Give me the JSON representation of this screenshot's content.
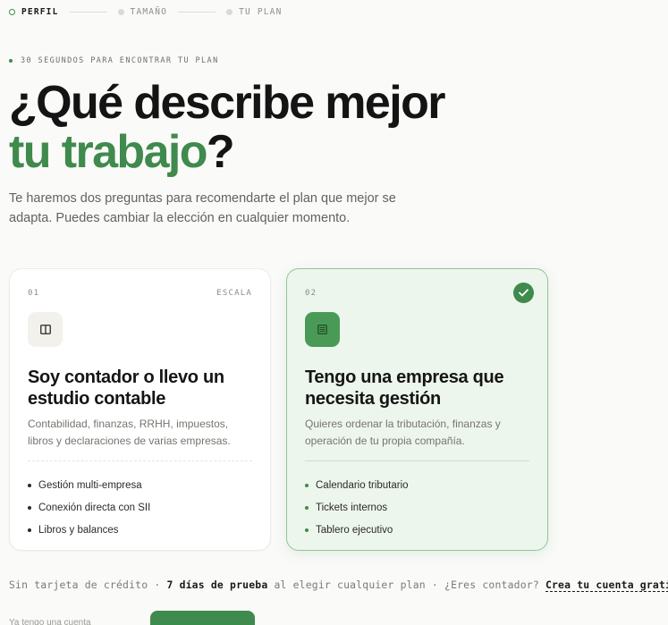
{
  "stepper": {
    "steps": [
      {
        "label": "PERFIL",
        "state": "active"
      },
      {
        "label": "TAMAÑO",
        "state": "inactive"
      },
      {
        "label": "TU PLAN",
        "state": "inactive"
      }
    ]
  },
  "eyebrow": "30 SEGUNDOS PARA ENCONTRAR TU PLAN",
  "headline": {
    "line1": "¿Qué describe mejor",
    "accent": "tu trabajo",
    "end": "?"
  },
  "subtitle": "Te haremos dos preguntas para recomendarte el plan que mejor se adapta. Puedes cambiar la elección en cualquier momento.",
  "cards": [
    {
      "number": "01",
      "tag": "ESCALA",
      "icon": "columns-icon",
      "title": "Soy contador o llevo un estudio contable",
      "description": "Contabilidad, finanzas, RRHH, impuestos, libros y declaraciones de varias empresas.",
      "features": [
        "Gestión multi-empresa",
        "Conexión directa con SII",
        "Libros y balances"
      ],
      "selected": false
    },
    {
      "number": "02",
      "tag": "",
      "icon": "building-icon",
      "title": "Tengo una empresa que necesita gestión",
      "description": "Quieres ordenar la tributación, finanzas y operación de tu propia compañía.",
      "features": [
        "Calendario tributario",
        "Tickets internos",
        "Tablero ejecutivo"
      ],
      "selected": true
    }
  ],
  "footer": {
    "part1": "Sin tarjeta de crédito · ",
    "trial": "7 días de prueba",
    "part2": " al elegir cualquier plan · ¿Eres contador? ",
    "link": "Crea tu cuenta gratis"
  },
  "bottom": {
    "left_text": "Ya tengo una cuenta"
  },
  "colors": {
    "accent": "#3f8a4d",
    "selected_bg": "#edf6ec",
    "selected_border": "#8fc896"
  }
}
